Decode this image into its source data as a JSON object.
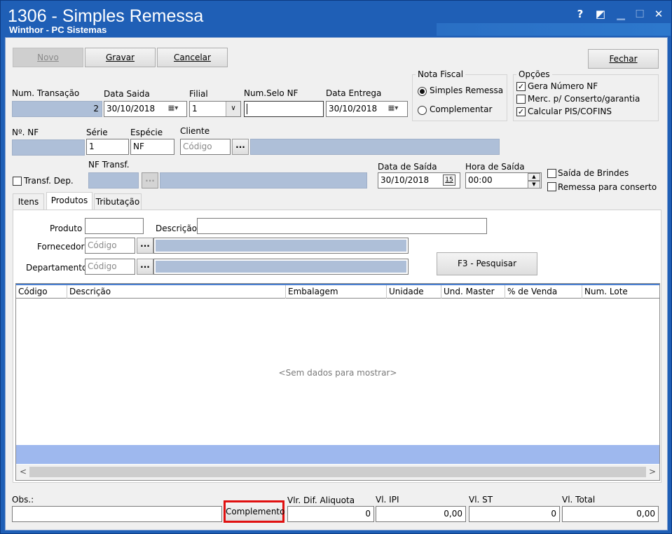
{
  "window": {
    "title": "1306 - Simples Remessa",
    "subtitle": "Winthor - PC Sistemas",
    "help_glyph": "?",
    "restore_glyph": "◩",
    "minimize_glyph": "▁",
    "maximize_glyph": "☐",
    "close_glyph": "✕"
  },
  "toolbar": {
    "novo_label": "Novo",
    "gravar_label": "Gravar",
    "cancelar_label": "Cancelar",
    "fechar_label": "Fechar"
  },
  "nota_fiscal": {
    "title": "Nota Fiscal",
    "simples_label": "Simples Remessa",
    "complementar_label": "Complementar",
    "selected": "Simples Remessa"
  },
  "opcoes": {
    "title": "Opções",
    "items": [
      {
        "label": "Gera Número NF",
        "checked": true
      },
      {
        "label": "Merc. p/ Conserto/garantia",
        "checked": false
      },
      {
        "label": "Calcular PIS/COFINS",
        "checked": true
      }
    ],
    "check_mark": "✓"
  },
  "header_fields": {
    "num_transacao_label": "Num. Transação",
    "num_transacao_value": "2",
    "data_saida_label": "Data Saida",
    "data_saida_value": "30/10/2018",
    "filial_label": "Filial",
    "filial_value": "1",
    "num_selo_label": "Num.Selo NF",
    "num_selo_value": "",
    "data_entrega_label": "Data Entrega",
    "data_entrega_value": "30/10/2018",
    "num_nf_label": "Nº. NF",
    "num_nf_value": "",
    "serie_label": "Série",
    "serie_value": "1",
    "especie_label": "Espécie",
    "especie_value": "NF",
    "cliente_label": "Cliente",
    "cliente_placeholder": "Código",
    "dots_label": "...",
    "transf_dep_label": "Transf. Dep.",
    "nf_transf_label": "NF Transf.",
    "data_de_saida_label": "Data de Saída",
    "data_de_saida_value": "30/10/2018",
    "calendar_day": "15",
    "hora_saida_label": "Hora de Saída",
    "hora_saida_value": "00:00",
    "saida_brindes_label": "Saída de Brindes",
    "remessa_conserto_label": "Remessa para conserto"
  },
  "tabs": [
    {
      "label": "Itens",
      "active": false
    },
    {
      "label": "Produtos",
      "active": true
    },
    {
      "label": "Tributação",
      "active": false
    }
  ],
  "produtos": {
    "produto_label": "Produto",
    "descricao_label": "Descrição",
    "fornecedor_label": "Fornecedor",
    "departamento_label": "Departamento",
    "codigo_placeholder": "Código",
    "pesquisar_label": "F3 - Pesquisar"
  },
  "grid": {
    "columns": [
      "Código",
      "Descrição",
      "Embalagem",
      "Unidade",
      "Und. Master",
      "% de Venda",
      "Num. Lote"
    ],
    "empty_text": "<Sem dados para mostrar>",
    "scroll_left": "<",
    "scroll_right": ">"
  },
  "footer": {
    "obs_label": "Obs.:",
    "complemento_label": "Complemento",
    "vlr_dif_label": "Vlr. Dif. Aliquota",
    "vlr_dif_value": "0",
    "vl_ipi_label": "Vl. IPI",
    "vl_ipi_value": "0,00",
    "vl_st_label": "Vl. ST",
    "vl_st_value": "0",
    "vl_total_label": "Vl. Total",
    "vl_total_value": "0,00"
  }
}
